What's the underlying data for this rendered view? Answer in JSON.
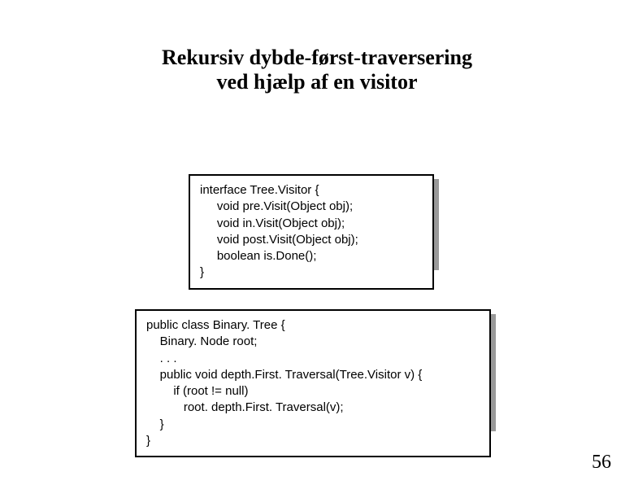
{
  "title_line1": "Rekursiv dybde-først-traversering",
  "title_line2": "ved hjælp af en visitor",
  "code1": "interface Tree.Visitor {\n     void pre.Visit(Object obj);\n     void in.Visit(Object obj);\n     void post.Visit(Object obj);\n     boolean is.Done();\n}",
  "code2": "public class Binary. Tree {\n    Binary. Node root;\n    . . .\n    public void depth.First. Traversal(Tree.Visitor v) {\n        if (root != null)\n           root. depth.First. Traversal(v);\n    }\n}",
  "pagenum": "56"
}
